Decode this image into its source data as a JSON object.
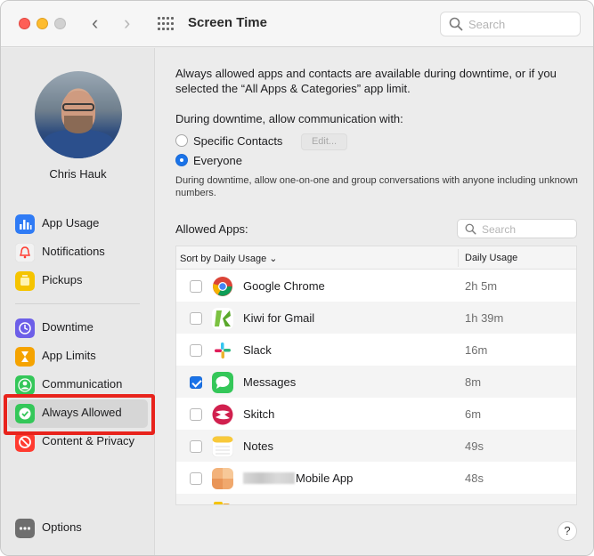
{
  "window": {
    "title": "Screen Time"
  },
  "toolbar": {
    "search_placeholder": "Search"
  },
  "user": {
    "name": "Chris Hauk"
  },
  "sidebar": {
    "items": [
      {
        "label": "App Usage",
        "icon": "bar-chart-icon",
        "color": "#2f7bf5"
      },
      {
        "label": "Notifications",
        "icon": "bell-icon",
        "color": "#f2f2f2"
      },
      {
        "label": "Pickups",
        "icon": "pickups-icon",
        "color": "#f5c400"
      },
      {
        "label": "Downtime",
        "icon": "downtime-icon",
        "color": "#6d5fe8"
      },
      {
        "label": "App Limits",
        "icon": "hourglass-icon",
        "color": "#f5a300"
      },
      {
        "label": "Communication",
        "icon": "person-icon",
        "color": "#34c759"
      },
      {
        "label": "Always Allowed",
        "icon": "checkmark-icon",
        "color": "#34c759"
      },
      {
        "label": "Content & Privacy",
        "icon": "restricted-icon",
        "color": "#ff3b30"
      }
    ],
    "options_label": "Options"
  },
  "main": {
    "description": "Always allowed apps and contacts are available during downtime, or if you selected the “All Apps & Categories” app limit.",
    "communication_label": "During downtime, allow communication with:",
    "radio_specific": "Specific Contacts",
    "edit_button": "Edit...",
    "radio_everyone": "Everyone",
    "note": "During downtime, allow one-on-one and group conversations with anyone including unknown numbers.",
    "allowed_apps_label": "Allowed Apps:",
    "apps_search_placeholder": "Search",
    "sort_label": "Sort by Daily Usage ⌄",
    "usage_header": "Daily Usage",
    "apps": [
      {
        "name": "Google Chrome",
        "usage": "2h 5m",
        "checked": false
      },
      {
        "name": "Kiwi for Gmail",
        "usage": "1h 39m",
        "checked": false
      },
      {
        "name": "Slack",
        "usage": "16m",
        "checked": false
      },
      {
        "name": "Messages",
        "usage": "8m",
        "checked": true
      },
      {
        "name": "Skitch",
        "usage": "6m",
        "checked": false
      },
      {
        "name": "Notes",
        "usage": "49s",
        "checked": false
      },
      {
        "name": "Mobile App",
        "usage": "48s",
        "checked": false
      }
    ],
    "help": "?"
  }
}
